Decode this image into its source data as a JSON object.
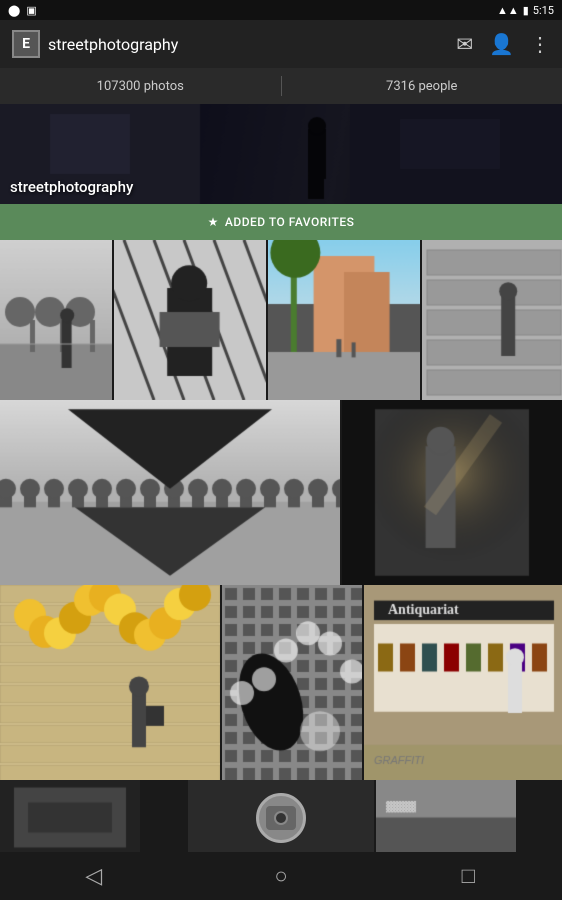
{
  "status_bar": {
    "time": "5:15",
    "icons_left": [
      "notification-dot",
      "screenshot-icon"
    ]
  },
  "app_bar": {
    "logo_letter": "E",
    "title": "streetphotography",
    "actions": [
      "mail-icon",
      "person-add-icon",
      "more-icon"
    ]
  },
  "stats": {
    "photos_count": "107300 photos",
    "people_count": "7316 people"
  },
  "hero": {
    "title": "streetphotography"
  },
  "favorites_button": {
    "label": "ADDED TO FAVORITES",
    "star": "★"
  },
  "grid": {
    "row1": [
      {
        "id": "r1c1",
        "style": "bw_street_person"
      },
      {
        "id": "r1c2",
        "style": "bw_shadow_reader"
      },
      {
        "id": "r1c3",
        "style": "color_palm_street"
      },
      {
        "id": "r1c4",
        "style": "bw_shuttered_walk"
      }
    ],
    "row2": [
      {
        "id": "r2c1",
        "style": "bw_triangle_reflection"
      },
      {
        "id": "r2c2",
        "style": "bw_doorway_woman"
      }
    ],
    "row3": [
      {
        "id": "r3c1",
        "style": "color_balloon_store"
      },
      {
        "id": "r3c2",
        "style": "bw_pattern_shadow"
      },
      {
        "id": "r3c3",
        "style": "color_antiquariat"
      }
    ]
  },
  "bottom_strip": [
    {
      "id": "ts1",
      "style": "bw_dark"
    },
    {
      "id": "ts2",
      "style": "color_camera"
    },
    {
      "id": "ts3",
      "style": "bw_text"
    }
  ],
  "nav": {
    "back_label": "◁",
    "home_label": "○",
    "recents_label": "□"
  }
}
